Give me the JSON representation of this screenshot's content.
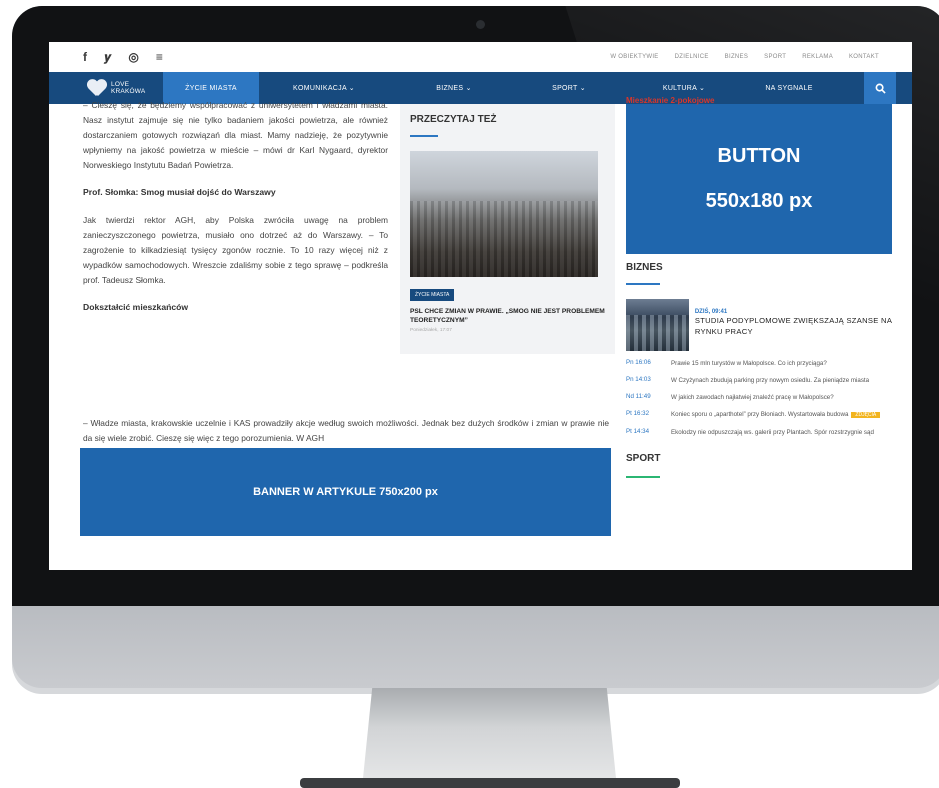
{
  "topbar": {
    "social": [
      "f",
      "𝒚",
      "◎",
      "≡"
    ],
    "links": [
      "W OBIEKTYWIE",
      "DZIELNICE",
      "BIZNES",
      "SPORT",
      "REKLAMA",
      "KONTAKT"
    ]
  },
  "nav": {
    "logo_line1": "LOVE",
    "logo_line2": "KRAKÓWA",
    "items": [
      "ŻYCIE MIASTA",
      "KOMUNIKACJA ⌄",
      "BIZNES ⌄",
      "SPORT ⌄",
      "KULTURA ⌄",
      "NA SYGNALE"
    ],
    "active": "ŻYCIE MIASTA"
  },
  "article": {
    "p1": "– Cieszę się, że będziemy współpracować z uniwersytetem i władzami miasta. Nasz instytut zajmuje się nie tylko badaniem jakości powietrza, ale również dostarczaniem gotowych rozwiązań dla miast. Mamy nadzieję, że pozytywnie wpłyniemy na jakość powietrza w mieście – mówi dr Karl Nygaard, dyrektor Norweskiego Instytutu Badań Powietrza.",
    "h1": "Prof. Słomka: Smog musiał dojść do Warszawy",
    "p2": "Jak twierdzi rektor AGH, aby Polska zwróciła uwagę na problem zanieczyszczonego powietrza, musiało ono dotrzeć aż do Warszawy. – To zagrożenie to kilkadziesiąt tysięcy zgonów rocznie. To 10 razy więcej niż z wypadków samochodowych. Wreszcie zdaliśmy sobie z tego sprawę – podkreśla prof. Tadeusz Słomka.",
    "h2": "Dokształcić mieszkańców",
    "p3": "– Władze miasta, krakowskie uczelnie i KAS prowadziły akcje według swoich możliwości. Jednak bez dużych środków i zmian w prawie nie da się wiele zrobić. Cieszę się więc z tego porozumienia. W AGH",
    "banner": "BANNER W ARTYKULE 750x200 px"
  },
  "read_also": {
    "title": "PRZECZYTAJ TEŻ",
    "category": "ŻYCIE MIASTA",
    "headline": "PSL CHCE ZMIAN W PRAWIE. „SMOG NIE JEST PROBLEMEM TEORETYCZNYM”",
    "date": "Poniedziałek, 17:07"
  },
  "sidebar": {
    "ad_top": "Mieszkanie 2-pokojowe",
    "ad_line1": "BUTTON",
    "ad_line2": "550x180 px",
    "biznes_title": "BIZNES",
    "feature_date": "DZIŚ, 09:41",
    "feature_title": "STUDIA PODYPLOMOWE ZWIĘKSZAJĄ SZANSE NA RYNKU PRACY",
    "news": [
      {
        "time": "Pn 16:06",
        "text": "Prawie 15 mln turystów w Małopolsce. Co ich przyciąga?",
        "tag": ""
      },
      {
        "time": "Pn 14:03",
        "text": "W Czyżynach zbudują parking przy nowym osiedlu. Za pieniądze miasta",
        "tag": ""
      },
      {
        "time": "Nd 11:49",
        "text": "W jakich zawodach najłatwiej znaleźć pracę w Małopolsce?",
        "tag": ""
      },
      {
        "time": "Pt 16:32",
        "text": "Koniec sporu o „aparthotel” przy Błoniach. Wystartowała budowa",
        "tag": "ZDJĘCIA"
      },
      {
        "time": "Pt 14:34",
        "text": "Ekolodzy nie odpuszczają ws. galerii przy Plantach. Spór rozstrzygnie sąd",
        "tag": ""
      }
    ],
    "sport_title": "SPORT"
  }
}
